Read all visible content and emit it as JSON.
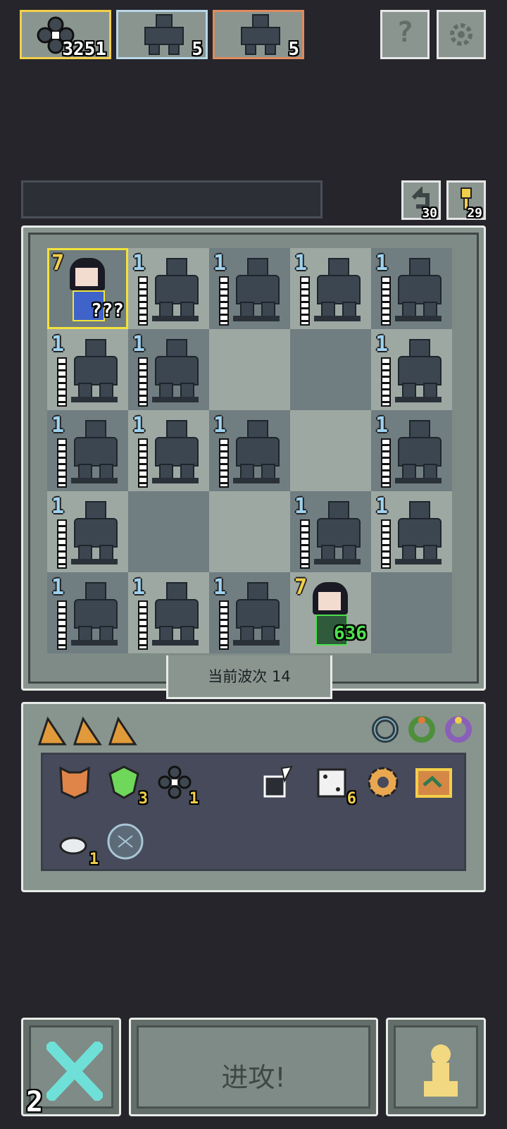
{
  "resources": {
    "gold_count": "3251",
    "blue_count": "5",
    "red_count": "5"
  },
  "top_buttons": {
    "help_glyph": "?",
    "settings_icon": "gear-icon"
  },
  "mini_counters": {
    "undo_count": "30",
    "key_count": "29"
  },
  "board": {
    "enemy_level": "1",
    "hero_top_level": "7",
    "hero_top_hp": "???",
    "hero_bottom_level": "7",
    "hero_bottom_hp": "636"
  },
  "wave": {
    "label": "当前波次 14"
  },
  "inventory": {
    "shield_count": "3",
    "gear_count": "1",
    "dice_count": "6",
    "cloud_count": "1"
  },
  "controls": {
    "attack_label": "进攻!",
    "close_count": "2"
  },
  "colors": {
    "background": "#25252b",
    "hp_green": "#4ee04e",
    "level_blue": "#9fd2ef",
    "level_gold": "#f2cf4a"
  }
}
